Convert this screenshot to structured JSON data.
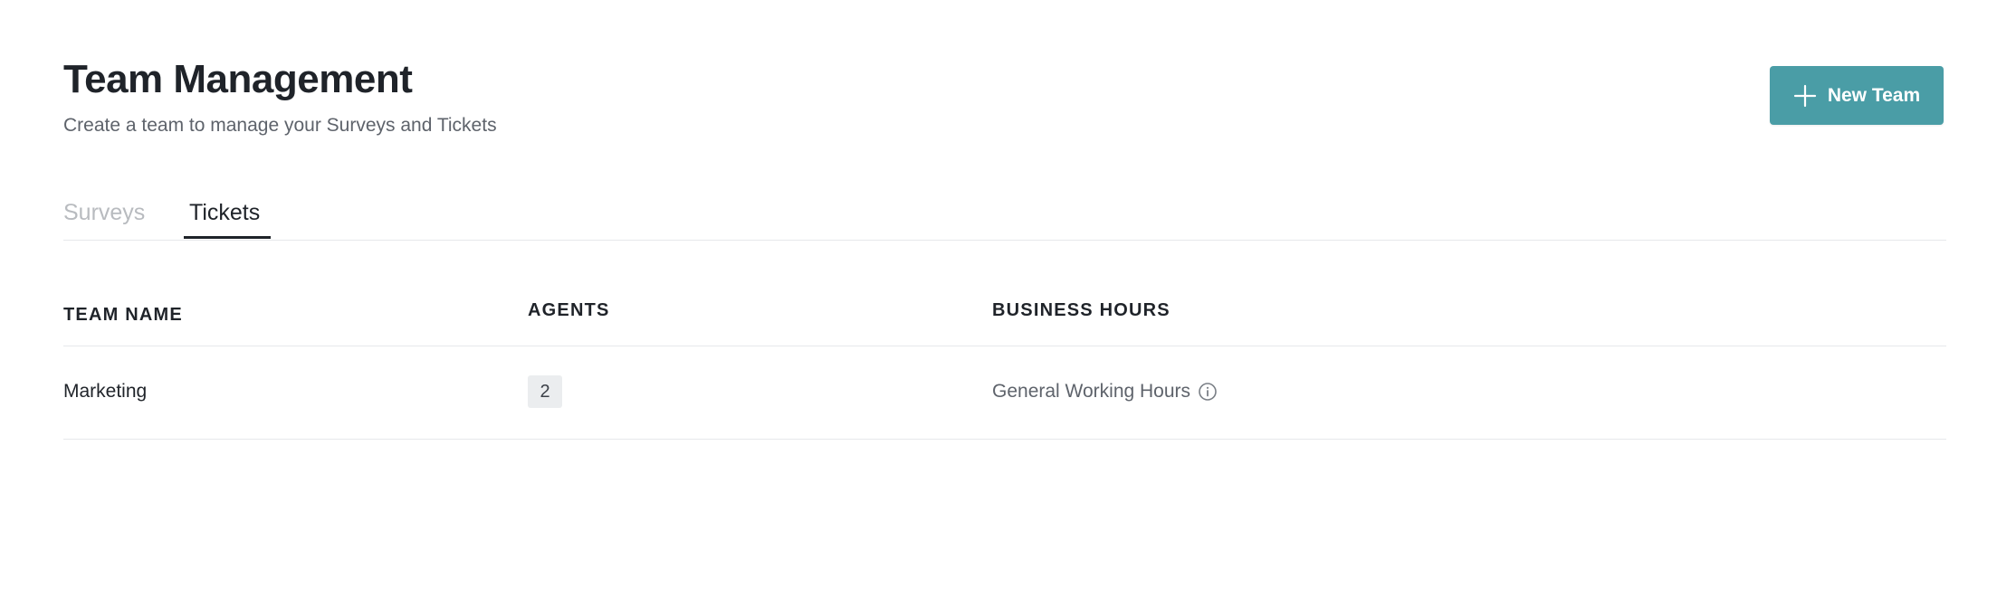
{
  "header": {
    "title": "Team Management",
    "subtitle": "Create a team to manage your Surveys and Tickets",
    "new_team_label": "New Team"
  },
  "tabs": [
    {
      "label": "Surveys",
      "active": false
    },
    {
      "label": "Tickets",
      "active": true
    }
  ],
  "table": {
    "columns": [
      "TEAM NAME",
      "AGENTS",
      "BUSINESS HOURS"
    ],
    "rows": [
      {
        "team_name": "Marketing",
        "agents": "2",
        "business_hours": "General Working Hours"
      }
    ]
  },
  "colors": {
    "accent": "#4a9da6",
    "text_primary": "#1f2329",
    "text_secondary": "#5e636b",
    "tab_inactive": "#b8bbbf"
  },
  "icons": {
    "new_team": "plus-icon",
    "business_hours_info": "info-icon"
  }
}
